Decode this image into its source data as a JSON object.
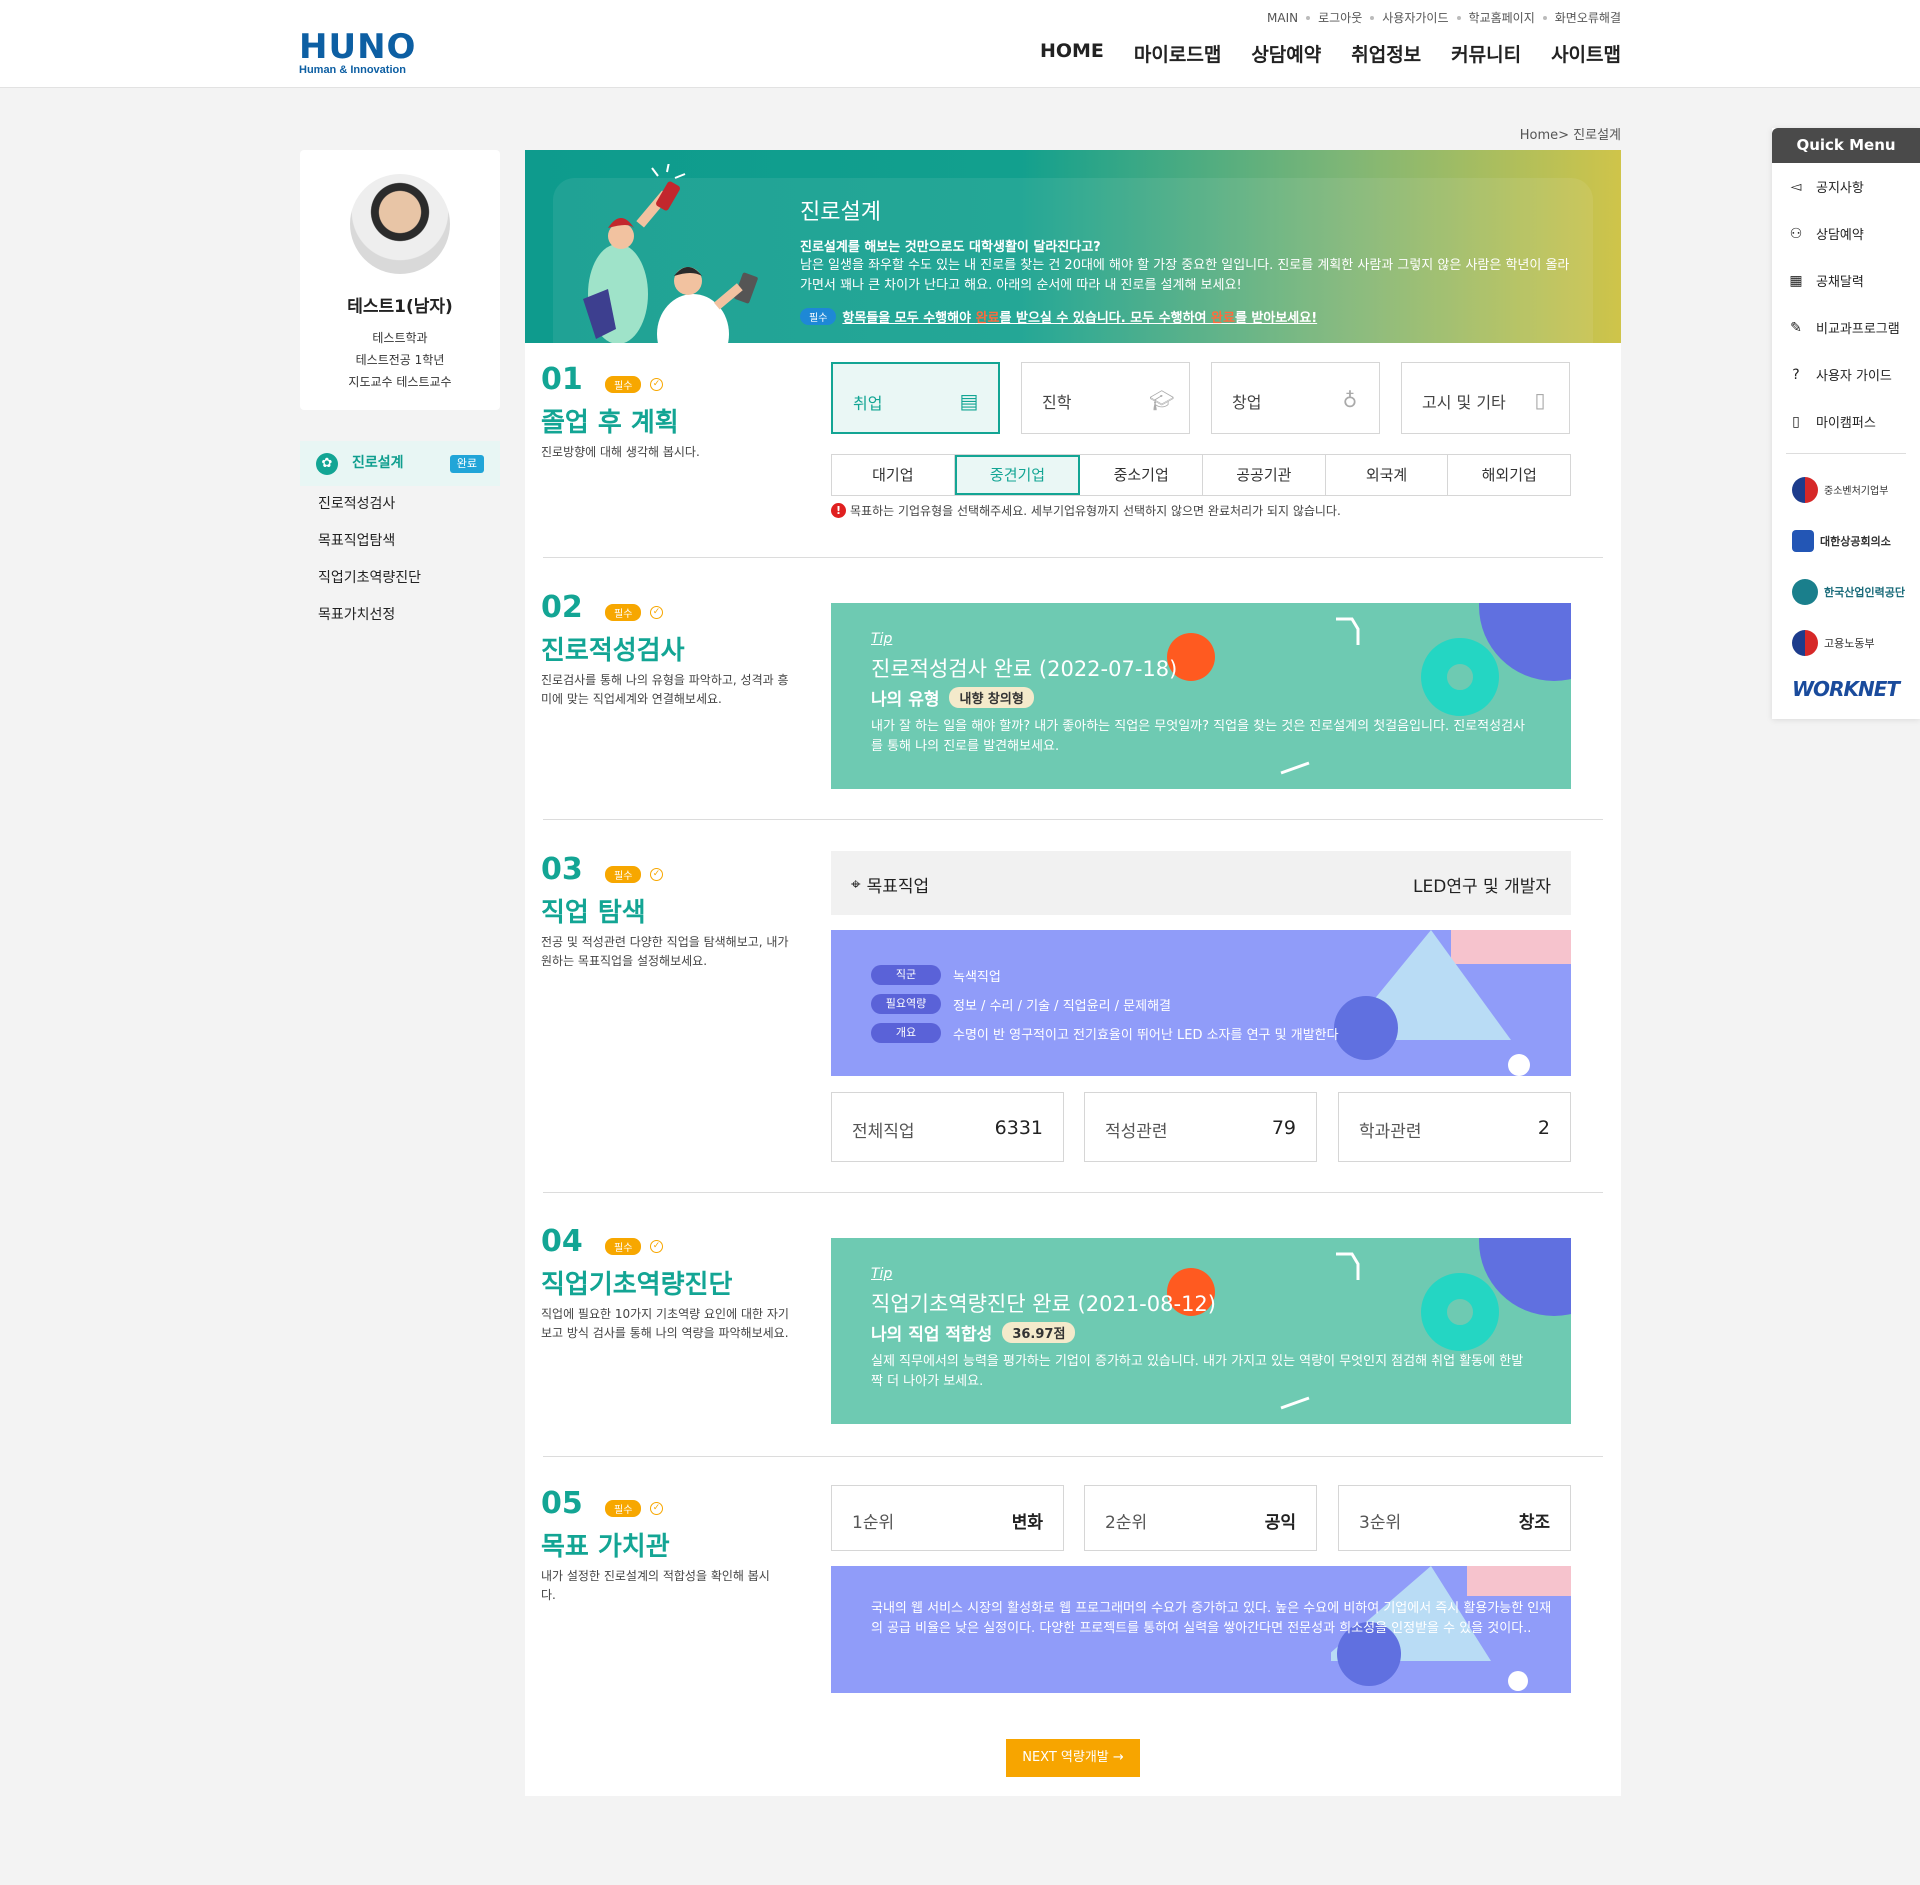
{
  "header": {
    "logo_main": "HUNO",
    "logo_sub": "Human & Innovation",
    "util_links": [
      "MAIN",
      "로그아웃",
      "사용자가이드",
      "학교홈페이지",
      "화면오류해결"
    ],
    "gnb": [
      "HOME",
      "마이로드맵",
      "상담예약",
      "취업정보",
      "커뮤니티",
      "사이트맵"
    ]
  },
  "breadcrumb": "Home> 진로설계",
  "profile": {
    "name": "테스트1(남자)",
    "dept": "테스트학과",
    "major": "테스트전공 1학년",
    "advisor": "지도교수 테스트교수"
  },
  "sidenav": {
    "items": [
      {
        "label": "진로설계",
        "badge": "완료"
      },
      {
        "label": "진로적성검사"
      },
      {
        "label": "목표직업탐색"
      },
      {
        "label": "직업기초역량진단"
      },
      {
        "label": "목표가치선정"
      }
    ]
  },
  "banner": {
    "title": "진로설계",
    "subtitle": "진로설계를 해보는 것만으로도 대학생활이 달라진다고?",
    "desc": "남은 일생을 좌우할 수도 있는 내 진로를 찾는 건 20대에 해야 할 가장 중요한 일입니다. 진로를 계획한 사람과 그렇지 않은 사람은 학년이 올라가면서 꽤나 큰 차이가 난다고 해요. 아래의 순서에 따라 내 진로를 설계해 보세요!",
    "note_badge": "필수",
    "note_part1": "항목들을 모두 수행해야 ",
    "note_hl1": "완료",
    "note_part2": "를 받으실 수 있습니다. 모두 수행하여 ",
    "note_hl2": "완료",
    "note_part3": "를 받아보세요!"
  },
  "required_badge": "필수",
  "sections": {
    "s1": {
      "num": "01",
      "title": "졸업 후 계획",
      "desc": "진로방향에 대해 생각해 봅시다.",
      "categories": [
        "취업",
        "진학",
        "창업",
        "고시 및 기타"
      ],
      "subtabs": [
        "대기업",
        "중견기업",
        "중소기업",
        "공공기관",
        "외국계",
        "해외기업"
      ],
      "warning": "목표하는 기업유형을 선택해주세요. 세부기업유형까지 선택하지 않으면 완료처리가 되지 않습니다."
    },
    "s2": {
      "num": "02",
      "title": "진로적성검사",
      "desc": "진로검사를 통해 나의 유형을 파악하고, 성격과 흥미에 맞는 직업세계와 연결해보세요.",
      "tip": "Tip",
      "card_title": "진로적성검사 완료 (2022-07-18)",
      "type_label": "나의 유형",
      "type_value": "내향 창의형",
      "card_desc": "내가 잘 하는 일을 해야 할까? 내가 좋아하는 직업은 무엇일까? 직업을 찾는 것은 진로설계의 첫걸음입니다. 진로적성검사를 통해 나의 진로를 발견해보세요."
    },
    "s3": {
      "num": "03",
      "title": "직업 탐색",
      "desc": "전공 및 적성관련 다양한 직업을 탐색해보고, 내가 원하는 목표직업을 설정해보세요.",
      "target_label": "목표직업",
      "target_value": "LED연구 및 개발자",
      "rows": [
        {
          "tag": "직군",
          "value": "녹색직업"
        },
        {
          "tag": "필요역량",
          "value": "정보 / 수리 / 기술 / 직업윤리 / 문제해결"
        },
        {
          "tag": "개요",
          "value": "수명이 반 영구적이고 전기효율이 뛰어난 LED 소자를 연구 및 개발한다"
        }
      ],
      "stats": [
        {
          "label": "전체직업",
          "value": "6331"
        },
        {
          "label": "적성관련",
          "value": "79"
        },
        {
          "label": "학과관련",
          "value": "2"
        }
      ]
    },
    "s4": {
      "num": "04",
      "title": "직업기초역량진단",
      "desc": "직업에 필요한 10가지 기초역량 요인에 대한 자기보고 방식 검사를 통해 나의 역량을 파악해보세요.",
      "tip": "Tip",
      "card_title": "직업기초역량진단 완료 (2021-08-12)",
      "fit_label": "나의 직업 적합성",
      "fit_value": "36.97점",
      "card_desc": "실제 직무에서의 능력을 평가하는 기업이 증가하고 있습니다. 내가 가지고 있는 역량이 무엇인지 점검해 취업 활동에 한발짝 더 나아가 보세요."
    },
    "s5": {
      "num": "05",
      "title": "목표 가치관",
      "desc": "내가 설정한 진로설계의 적합성을 확인해 봅시다.",
      "ranks": [
        {
          "label": "1순위",
          "value": "변화"
        },
        {
          "label": "2순위",
          "value": "공익"
        },
        {
          "label": "3순위",
          "value": "창조"
        }
      ],
      "card_desc": "국내의 웹 서비스 시장의 활성화로 웹 프로그래머의 수요가 증가하고 있다. 높은 수요에 비하여 기업에서 즉시 활용가능한 인재의 공급 비율은 낮은 실정이다. 다양한 프로젝트를 통하여 실력을 쌓아간다면 전문성과 희소성을 인정받을 수 있을 것이다.."
    }
  },
  "next_button": "NEXT 역량개발 →",
  "quick_menu": {
    "title": "Quick Menu",
    "items": [
      "공지사항",
      "상담예약",
      "공채달력",
      "비교과프로그램",
      "사용자 가이드",
      "마이캠퍼스"
    ],
    "logos": [
      "중소벤처기업부",
      "대한상공회의소",
      "한국산업인력공단",
      "고용노동부",
      "WORKNET"
    ]
  }
}
